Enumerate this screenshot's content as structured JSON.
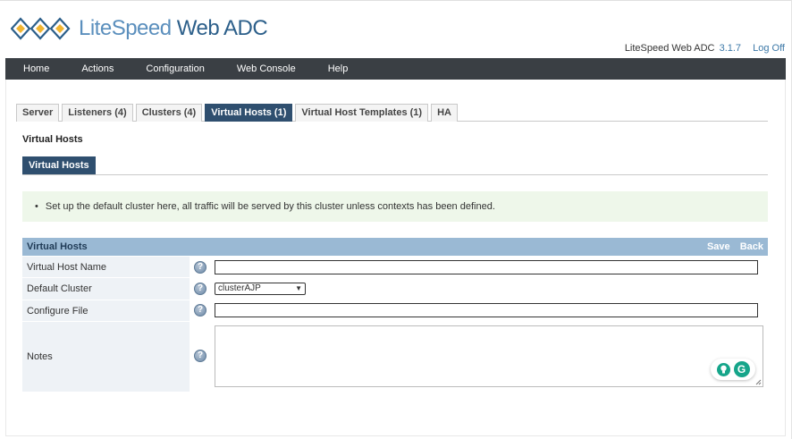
{
  "brand": {
    "logo_text_lite": "LiteSpeed",
    "logo_text_rest": " Web ADC",
    "product_label": "LiteSpeed Web ADC",
    "version": "3.1.7",
    "logoff_label": "Log Off",
    "accent_color": "#3d79a8"
  },
  "nav": {
    "items": [
      {
        "label": "Home"
      },
      {
        "label": "Actions"
      },
      {
        "label": "Configuration"
      },
      {
        "label": "Web Console"
      },
      {
        "label": "Help"
      }
    ]
  },
  "tabs": [
    {
      "label": "Server",
      "active": false
    },
    {
      "label": "Listeners (4)",
      "active": false
    },
    {
      "label": "Clusters (4)",
      "active": false
    },
    {
      "label": "Virtual Hosts (1)",
      "active": true
    },
    {
      "label": "Virtual Host Templates (1)",
      "active": false
    },
    {
      "label": "HA",
      "active": false
    }
  ],
  "page": {
    "title": "Virtual Hosts",
    "subtab": "Virtual Hosts",
    "info_bullet": "•",
    "info_text": "Set up the default cluster here, all traffic will be served by this cluster unless contexts has been defined."
  },
  "form": {
    "title": "Virtual Hosts",
    "save_label": "Save",
    "back_label": "Back",
    "fields": {
      "vhost_name": {
        "label": "Virtual Host Name",
        "value": ""
      },
      "default_cluster": {
        "label": "Default Cluster",
        "value": "clusterAJP"
      },
      "config_file": {
        "label": "Configure File",
        "value": ""
      },
      "notes": {
        "label": "Notes",
        "value": ""
      }
    },
    "help_glyph": "?"
  },
  "grammar_badge": {
    "letter": "G"
  }
}
